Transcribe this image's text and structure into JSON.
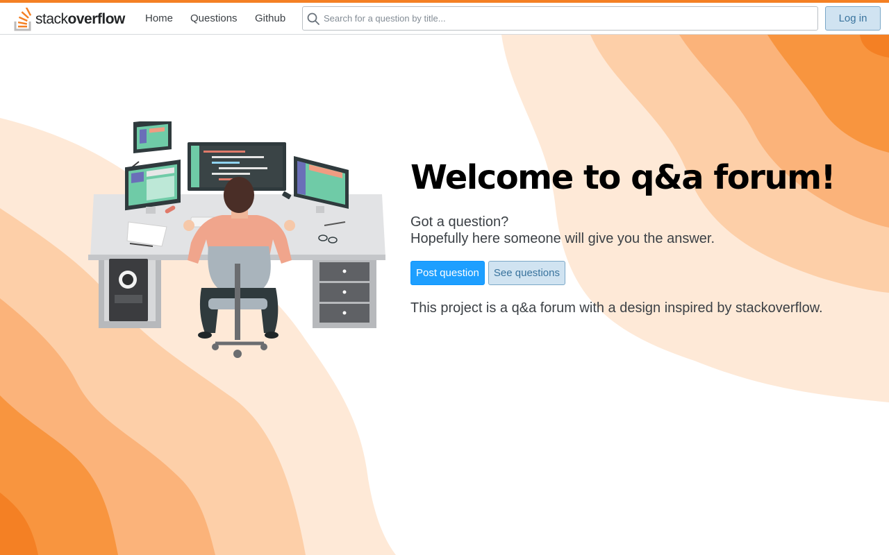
{
  "brand": {
    "name_light": "stack",
    "name_bold": "overflow",
    "accent": "#f48024"
  },
  "nav": {
    "home": "Home",
    "questions": "Questions",
    "github": "Github"
  },
  "search": {
    "placeholder": "Search for a question by title...",
    "value": "",
    "icon": "search-icon"
  },
  "auth": {
    "login_label": "Log in"
  },
  "hero": {
    "title": "Welcome to q&a forum!",
    "subtitle_line1": "Got a question?",
    "subtitle_line2": "Hopefully here someone will give you the answer.",
    "post_button": "Post question",
    "see_button": "See questions",
    "description": "This project is a q&a forum with a design inspired by stackoverflow."
  },
  "colors": {
    "primary": "#1e9fff",
    "secondary_bg": "#d0e3f1",
    "wave_1": "#fee9d7",
    "wave_2": "#fdcfa8",
    "wave_3": "#fbb37a",
    "wave_4": "#f8953f"
  }
}
